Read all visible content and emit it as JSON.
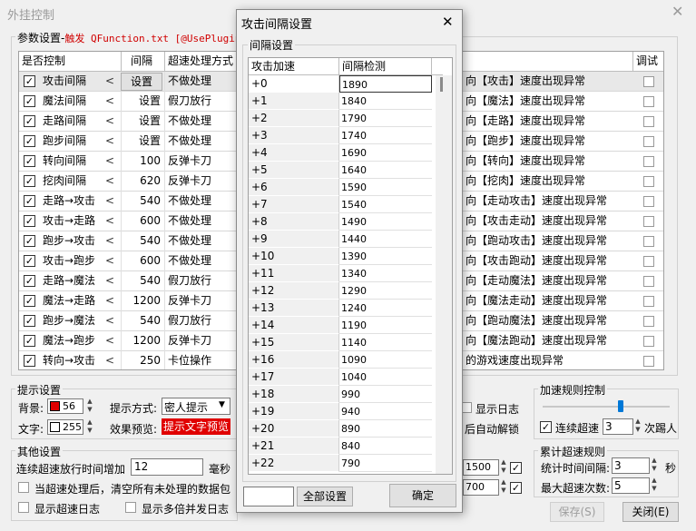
{
  "window": {
    "title": "外挂控制",
    "close_glyph": "✕"
  },
  "params_group": {
    "label_prefix": "参数设置-",
    "label_red": "触发 QFunction.txt [@UsePlugin]"
  },
  "grid": {
    "headers": [
      "是否控制",
      "间隔",
      "超速处理方式",
      "调试"
    ],
    "rows": [
      {
        "name": "攻击间隔",
        "interval": "设置",
        "mode": "不做处理",
        "msg": "向【攻击】速度出现异常"
      },
      {
        "name": "魔法间隔",
        "interval": "设置",
        "mode": "假刀放行",
        "msg": "向【魔法】速度出现异常"
      },
      {
        "name": "走路间隔",
        "interval": "设置",
        "mode": "不做处理",
        "msg": "向【走路】速度出现异常"
      },
      {
        "name": "跑步间隔",
        "interval": "设置",
        "mode": "不做处理",
        "msg": "向【跑步】速度出现异常"
      },
      {
        "name": "转向间隔",
        "interval": "100",
        "mode": "反弹卡刀",
        "msg": "向【转向】速度出现异常"
      },
      {
        "name": "挖肉间隔",
        "interval": "620",
        "mode": "反弹卡刀",
        "msg": "向【挖肉】速度出现异常"
      },
      {
        "name": "走路→攻击",
        "interval": "540",
        "mode": "不做处理",
        "msg": "向【走动攻击】速度出现异常"
      },
      {
        "name": "攻击→走路",
        "interval": "600",
        "mode": "不做处理",
        "msg": "向【攻击走动】速度出现异常"
      },
      {
        "name": "跑步→攻击",
        "interval": "540",
        "mode": "不做处理",
        "msg": "向【跑动攻击】速度出现异常"
      },
      {
        "name": "攻击→跑步",
        "interval": "600",
        "mode": "不做处理",
        "msg": "向【攻击跑动】速度出现异常"
      },
      {
        "name": "走路→魔法",
        "interval": "540",
        "mode": "假刀放行",
        "msg": "向【走动魔法】速度出现异常"
      },
      {
        "name": "魔法→走路",
        "interval": "1200",
        "mode": "反弹卡刀",
        "msg": "向【魔法走动】速度出现异常"
      },
      {
        "name": "跑步→魔法",
        "interval": "540",
        "mode": "假刀放行",
        "msg": "向【跑动魔法】速度出现异常"
      },
      {
        "name": "魔法→跑步",
        "interval": "1200",
        "mode": "反弹卡刀",
        "msg": "向【魔法跑动】速度出现异常"
      },
      {
        "name": "转向→攻击",
        "interval": "250",
        "mode": "卡位操作",
        "msg": "的游戏速度出现异常"
      }
    ]
  },
  "hint_group": {
    "label": "提示设置",
    "bg_label": "背景:",
    "bg_value": "56",
    "bg_color": "#e00000",
    "text_label": "文字:",
    "text_value": "255",
    "text_color": "#ffffff",
    "mode_label": "提示方式:",
    "mode_value": "密人提示",
    "preview_label": "效果预览:",
    "preview_text": "提示文字预览",
    "show_log": "显示日志",
    "auto_unlock": "后自动解锁"
  },
  "other_group": {
    "label": "其他设置",
    "add_time_label": "连续超速放行时间增加",
    "add_time_value": "12",
    "unit_ms": "毫秒",
    "opt1": "当超速处理后，清空所有未处理的数据包",
    "opt2": "显示超速日志",
    "opt3": "显示多倍并发日志",
    "val1": "1500",
    "val2": "700"
  },
  "accel_group": {
    "label": "加速规则控制",
    "kick_label": "连续超速",
    "kick_value": "3",
    "kick_suffix": "次踢人"
  },
  "cum_group": {
    "label": "累计超速规则",
    "time_label": "统计时间间隔:",
    "time_value": "3",
    "time_unit": "秒",
    "max_label": "最大超速次数:",
    "max_value": "5"
  },
  "buttons": {
    "save": "保存(S)",
    "close": "关闭(E)"
  },
  "dialog": {
    "title": "攻击间隔设置",
    "group_label": "间隔设置",
    "col1": "攻击加速",
    "col2": "间隔检测",
    "rows": [
      [
        "+0",
        "1890"
      ],
      [
        "+1",
        "1840"
      ],
      [
        "+2",
        "1790"
      ],
      [
        "+3",
        "1740"
      ],
      [
        "+4",
        "1690"
      ],
      [
        "+5",
        "1640"
      ],
      [
        "+6",
        "1590"
      ],
      [
        "+7",
        "1540"
      ],
      [
        "+8",
        "1490"
      ],
      [
        "+9",
        "1440"
      ],
      [
        "+10",
        "1390"
      ],
      [
        "+11",
        "1340"
      ],
      [
        "+12",
        "1290"
      ],
      [
        "+13",
        "1240"
      ],
      [
        "+14",
        "1190"
      ],
      [
        "+15",
        "1140"
      ],
      [
        "+16",
        "1090"
      ],
      [
        "+17",
        "1040"
      ],
      [
        "+18",
        "990"
      ],
      [
        "+19",
        "940"
      ],
      [
        "+20",
        "890"
      ],
      [
        "+21",
        "840"
      ],
      [
        "+22",
        "790"
      ]
    ],
    "all_button": "全部设置",
    "ok_button": "确定"
  }
}
